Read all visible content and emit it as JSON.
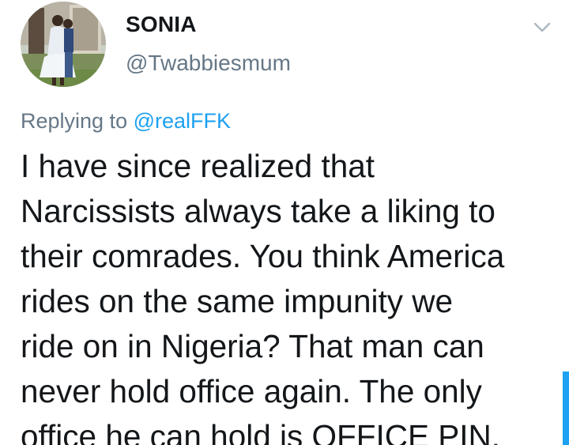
{
  "author": {
    "display_name": "SONIA",
    "handle": "@Twabbiesmum"
  },
  "reply": {
    "prefix": "Replying to ",
    "mention": "@realFFK"
  },
  "tweet": {
    "lines": [
      "I have since realized that",
      "Narcissists always take a liking to",
      "their comrades. You think America",
      "rides on the same impunity we",
      "ride on in Nigeria? That man can",
      "never hold office again. The only",
      "office he can hold is OFFICE PIN."
    ]
  },
  "icons": {
    "menu": "chevron-down-icon",
    "avatar": "profile-photo"
  },
  "colors": {
    "text_primary": "#14171a",
    "text_secondary": "#657786",
    "accent": "#1da1f2",
    "background": "#ffffff"
  }
}
